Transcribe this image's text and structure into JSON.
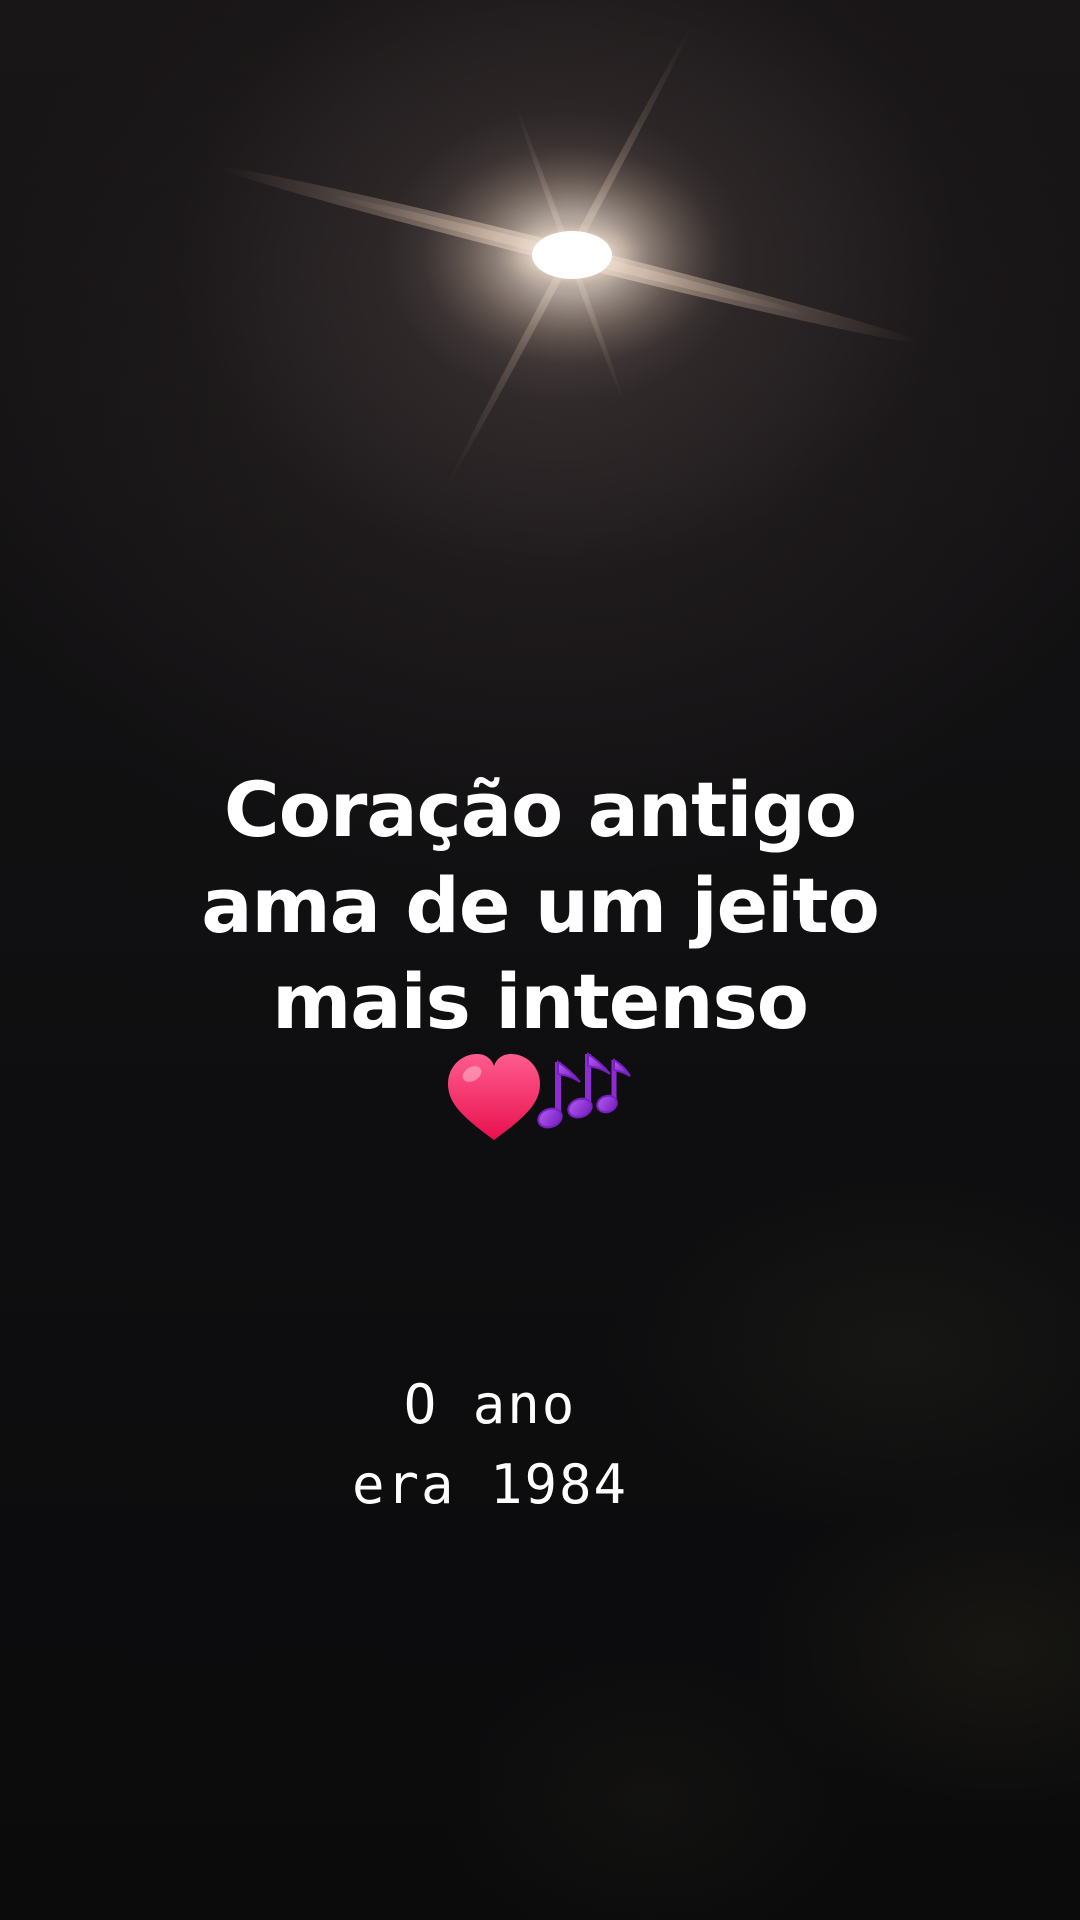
{
  "story": {
    "caption_lines": [
      "Coração antigo",
      "ama de um jeito",
      "mais intenso"
    ],
    "emojis": [
      "heart-icon",
      "music-notes-icon"
    ],
    "secondary_lines": [
      "O ano",
      "era 1984"
    ],
    "colors": {
      "text": "#ffffff",
      "heart": "#ff2f6d",
      "notes": "#8e2bd4",
      "background": "#0e0e10"
    }
  }
}
